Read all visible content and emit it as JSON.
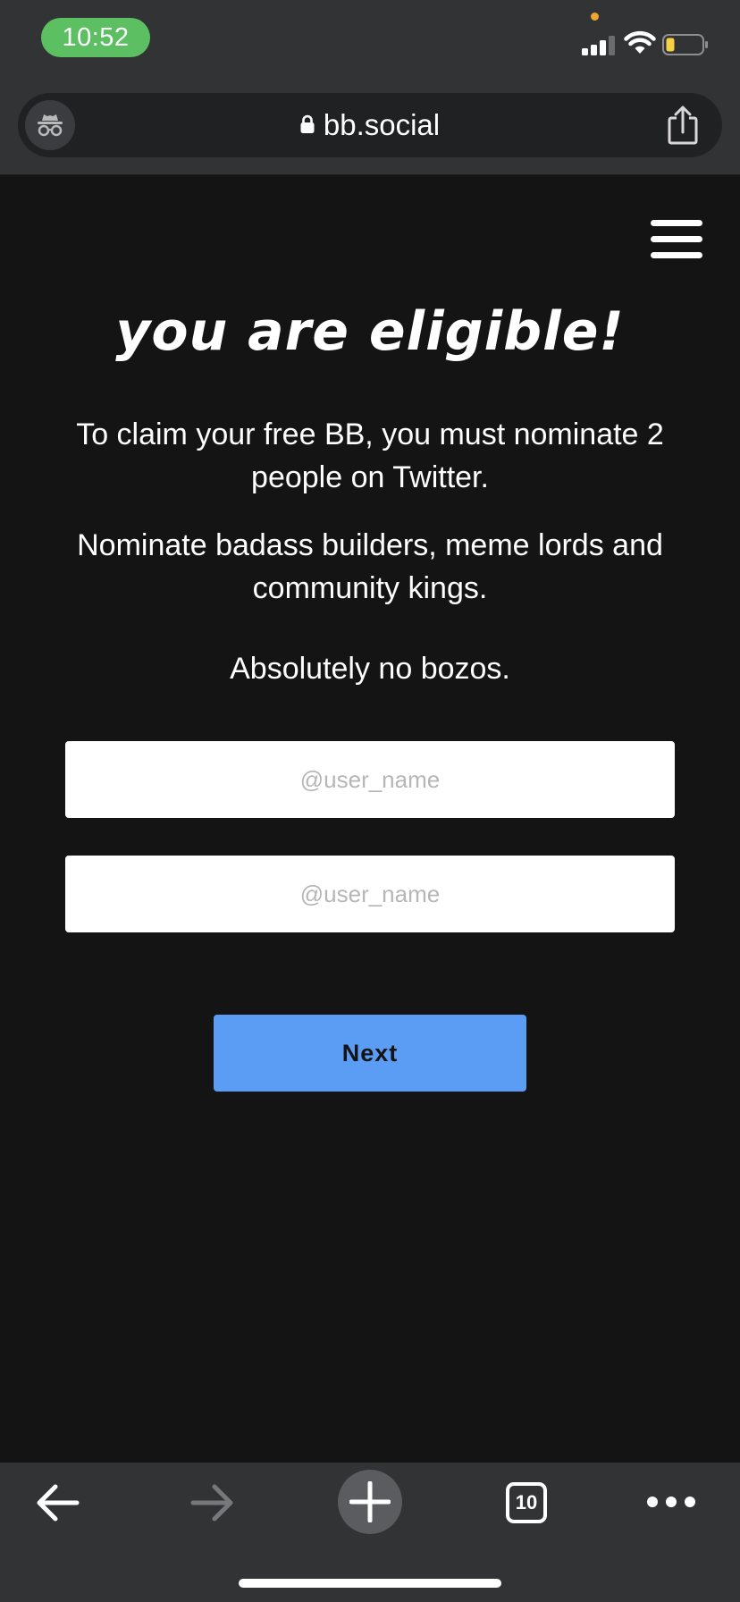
{
  "status_bar": {
    "time": "10:52",
    "time_pill_color": "#5cc062",
    "icons": [
      "signal-icon",
      "wifi-icon",
      "battery-icon"
    ]
  },
  "address_bar": {
    "url": "bb.social",
    "left_icon": "incognito-icon",
    "right_icon": "share-icon"
  },
  "page": {
    "menu_icon": "hamburger-menu-icon",
    "headline": "you are eligible!",
    "paragraph_1": "To claim your free BB, you must nominate 2 people on Twitter.",
    "paragraph_2": "Nominate badass builders, meme lords and community kings.",
    "paragraph_3": "Absolutely no bozos.",
    "input_1_placeholder": "@user_name",
    "input_2_placeholder": "@user_name",
    "next_label": "Next",
    "accent_color": "#5b9cf5",
    "background_color": "#141415"
  },
  "toolbar": {
    "back_icon": "back-arrow-icon",
    "forward_icon": "forward-arrow-icon",
    "new_tab_icon": "plus-icon",
    "tab_count": "10",
    "more_icon": "more-dots-icon"
  }
}
